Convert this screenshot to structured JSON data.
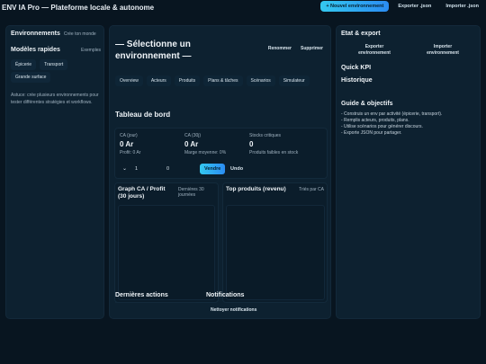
{
  "app": {
    "title": "ENV IA Pro — Plateforme locale & autonome",
    "new_env_label": "+ Nouvel environnement",
    "export_label": "Exporter .json",
    "import_label": "Importer .json",
    "accent": "#34c8f0"
  },
  "left": {
    "env_title": "Environnements",
    "env_sub": "Crée ton monde",
    "models_title": "Modèles rapides",
    "models_sub": "Exemples",
    "models": [
      "Épicerie",
      "Transport",
      "Grande surface"
    ],
    "tip": "Astuce: crée plusieurs environnements pour tester différentes stratégies et workflows."
  },
  "center": {
    "heading": "— Sélectionne un environnement —",
    "rename_label": "Renommer",
    "delete_label": "Supprimer",
    "tabs": [
      "Overview",
      "Acteurs",
      "Produits",
      "Plans & tâches",
      "Scénarios",
      "Simulateur"
    ],
    "dashboard_title": "Tableau de bord",
    "kpi": [
      {
        "label": "CA (jour)",
        "value": "0 Ar",
        "sub": "Profit: 0 Ar"
      },
      {
        "label": "CA (30j)",
        "value": "0 Ar",
        "sub": "Marge moyenne: 0%"
      },
      {
        "label": "Stocks critiques",
        "value": "0",
        "sub": "Produits faibles en stock"
      }
    ],
    "sell_qty": "1",
    "sell_price": "0",
    "sell_label": "Vendre",
    "undo_label": "Undo",
    "graph_title": "Graph CA / Profit (30 jours)",
    "graph_sub": "Dernières 30 journées",
    "top_title": "Top produits (revenu)",
    "top_sub": "Triés par CA",
    "last_actions_title": "Dernières actions",
    "notifications_title": "Notifications",
    "clear_notifications_label": "Nettoyer notifications"
  },
  "right": {
    "state_title": "Etat & export",
    "export_env_label": "Exporter environnement",
    "import_env_label": "Importer environnement",
    "quick_kpi_title": "Quick KPI",
    "history_title": "Historique",
    "guide_title": "Guide & objectifs",
    "guide_items": [
      "- Construis un env par activité (épicerie, transport).",
      "- Remplis acteurs, produits, plans.",
      "- Utilise scénarios pour générer discours.",
      "- Exporte JSON pour partager."
    ]
  }
}
